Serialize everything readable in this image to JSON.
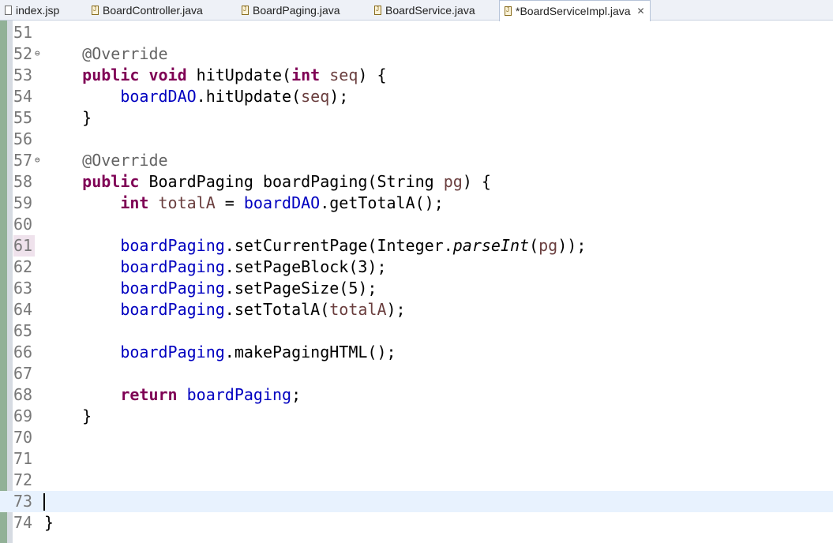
{
  "tabs": [
    {
      "label": "index.jsp",
      "icon": "jsp-file-icon",
      "active": false
    },
    {
      "label": "BoardController.java",
      "icon": "java-file-icon",
      "active": false
    },
    {
      "label": "BoardPaging.java",
      "icon": "java-file-icon",
      "active": false
    },
    {
      "label": "BoardService.java",
      "icon": "java-file-icon",
      "active": false
    },
    {
      "label": "*BoardServiceImpl.java",
      "icon": "java-file-icon",
      "active": true,
      "close": "✕"
    }
  ],
  "colors": {
    "keyword": "#7f0055",
    "annotation": "#646464",
    "field": "#0000c0",
    "local": "#6a3e3e",
    "current_line": "#e8f2fe",
    "ruler": "#92b197"
  },
  "lines": [
    {
      "n": "51",
      "tokens": []
    },
    {
      "n": "52",
      "fold": "⊖",
      "tokens": [
        {
          "t": "    "
        },
        {
          "t": "@Override",
          "c": "ann"
        }
      ]
    },
    {
      "n": "53",
      "tokens": [
        {
          "t": "    "
        },
        {
          "t": "public",
          "c": "kw"
        },
        {
          "t": " "
        },
        {
          "t": "void",
          "c": "kw"
        },
        {
          "t": " hitUpdate("
        },
        {
          "t": "int",
          "c": "kw"
        },
        {
          "t": " "
        },
        {
          "t": "seq",
          "c": "loc"
        },
        {
          "t": ") {"
        }
      ]
    },
    {
      "n": "54",
      "tokens": [
        {
          "t": "        "
        },
        {
          "t": "boardDAO",
          "c": "fld"
        },
        {
          "t": ".hitUpdate("
        },
        {
          "t": "seq",
          "c": "loc"
        },
        {
          "t": ");"
        }
      ]
    },
    {
      "n": "55",
      "tokens": [
        {
          "t": "    }"
        }
      ]
    },
    {
      "n": "56",
      "tokens": []
    },
    {
      "n": "57",
      "fold": "⊖",
      "tokens": [
        {
          "t": "    "
        },
        {
          "t": "@Override",
          "c": "ann"
        }
      ]
    },
    {
      "n": "58",
      "tokens": [
        {
          "t": "    "
        },
        {
          "t": "public",
          "c": "kw"
        },
        {
          "t": " BoardPaging boardPaging(String "
        },
        {
          "t": "pg",
          "c": "loc"
        },
        {
          "t": ") {"
        }
      ]
    },
    {
      "n": "59",
      "tokens": [
        {
          "t": "        "
        },
        {
          "t": "int",
          "c": "kw"
        },
        {
          "t": " "
        },
        {
          "t": "totalA",
          "c": "loc"
        },
        {
          "t": " = "
        },
        {
          "t": "boardDAO",
          "c": "fld"
        },
        {
          "t": ".getTotalA();"
        }
      ]
    },
    {
      "n": "60",
      "tokens": []
    },
    {
      "n": "61",
      "mod": true,
      "tokens": [
        {
          "t": "        "
        },
        {
          "t": "boardPaging",
          "c": "fld"
        },
        {
          "t": ".setCurrentPage(Integer."
        },
        {
          "t": "parseInt",
          "c": "it"
        },
        {
          "t": "("
        },
        {
          "t": "pg",
          "c": "loc"
        },
        {
          "t": "));"
        }
      ]
    },
    {
      "n": "62",
      "tokens": [
        {
          "t": "        "
        },
        {
          "t": "boardPaging",
          "c": "fld"
        },
        {
          "t": ".setPageBlock(3);"
        }
      ]
    },
    {
      "n": "63",
      "tokens": [
        {
          "t": "        "
        },
        {
          "t": "boardPaging",
          "c": "fld"
        },
        {
          "t": ".setPageSize(5);"
        }
      ]
    },
    {
      "n": "64",
      "tokens": [
        {
          "t": "        "
        },
        {
          "t": "boardPaging",
          "c": "fld"
        },
        {
          "t": ".setTotalA("
        },
        {
          "t": "totalA",
          "c": "loc"
        },
        {
          "t": ");"
        }
      ]
    },
    {
      "n": "65",
      "tokens": []
    },
    {
      "n": "66",
      "tokens": [
        {
          "t": "        "
        },
        {
          "t": "boardPaging",
          "c": "fld"
        },
        {
          "t": ".makePagingHTML();"
        }
      ]
    },
    {
      "n": "67",
      "tokens": []
    },
    {
      "n": "68",
      "tokens": [
        {
          "t": "        "
        },
        {
          "t": "return",
          "c": "kw"
        },
        {
          "t": " "
        },
        {
          "t": "boardPaging",
          "c": "fld"
        },
        {
          "t": ";"
        }
      ]
    },
    {
      "n": "69",
      "tokens": [
        {
          "t": "    }"
        }
      ]
    },
    {
      "n": "70",
      "tokens": []
    },
    {
      "n": "71",
      "tokens": []
    },
    {
      "n": "72",
      "tokens": []
    },
    {
      "n": "73",
      "current": true,
      "tokens": []
    },
    {
      "n": "74",
      "tokens": [
        {
          "t": "}"
        }
      ]
    }
  ]
}
